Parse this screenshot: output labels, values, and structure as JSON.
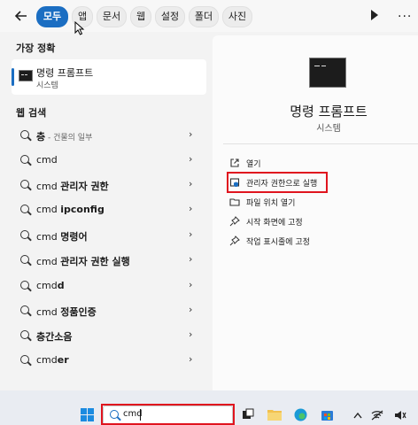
{
  "topbar": {
    "back_label": "←",
    "tabs": [
      {
        "label": "모두",
        "active": true
      },
      {
        "label": "앱",
        "active": false
      },
      {
        "label": "문서",
        "active": false
      },
      {
        "label": "웹",
        "active": false
      },
      {
        "label": "설정",
        "active": false
      },
      {
        "label": "폴더",
        "active": false
      },
      {
        "label": "사진",
        "active": false
      }
    ],
    "more_label": "..."
  },
  "left": {
    "best_match_title": "가장 정확",
    "best_match": {
      "name": "명령 프롬프트",
      "type": "시스템"
    },
    "web_title": "웹 검색",
    "results": [
      {
        "bold": "층",
        "normal": "",
        "small": " - 건물의 일부"
      },
      {
        "bold": "",
        "normal": "cmd",
        "small": ""
      },
      {
        "bold": "관리자 권한",
        "normal": "cmd ",
        "small": ""
      },
      {
        "bold": "ipconfig",
        "normal": "cmd ",
        "small": ""
      },
      {
        "bold": "명령어",
        "normal": "cmd ",
        "small": ""
      },
      {
        "bold": "관리자 권한 실행",
        "normal": "cmd ",
        "small": ""
      },
      {
        "bold": "d",
        "normal": "cmd",
        "small": ""
      },
      {
        "bold": "정품인증",
        "normal": "cmd ",
        "small": ""
      },
      {
        "bold": "층간소음",
        "normal": "",
        "small": ""
      },
      {
        "bold": "er",
        "normal": "cmd",
        "small": ""
      }
    ],
    "chevron": "›"
  },
  "right": {
    "app_name": "명령 프롬프트",
    "app_type": "시스템",
    "actions": [
      {
        "label": "열기",
        "icon": "open-external-icon"
      },
      {
        "label": "관리자 권한으로 실행",
        "icon": "run-as-admin-icon"
      },
      {
        "label": "파일 위치 열기",
        "icon": "folder-icon"
      },
      {
        "label": "시작 화면에 고정",
        "icon": "pin-icon"
      },
      {
        "label": "작업 표시줄에 고정",
        "icon": "pin-icon"
      }
    ]
  },
  "taskbar": {
    "search_value": "cmd",
    "colors": {
      "accent": "#1b6ec2",
      "highlight_box": "#e0141e"
    }
  }
}
